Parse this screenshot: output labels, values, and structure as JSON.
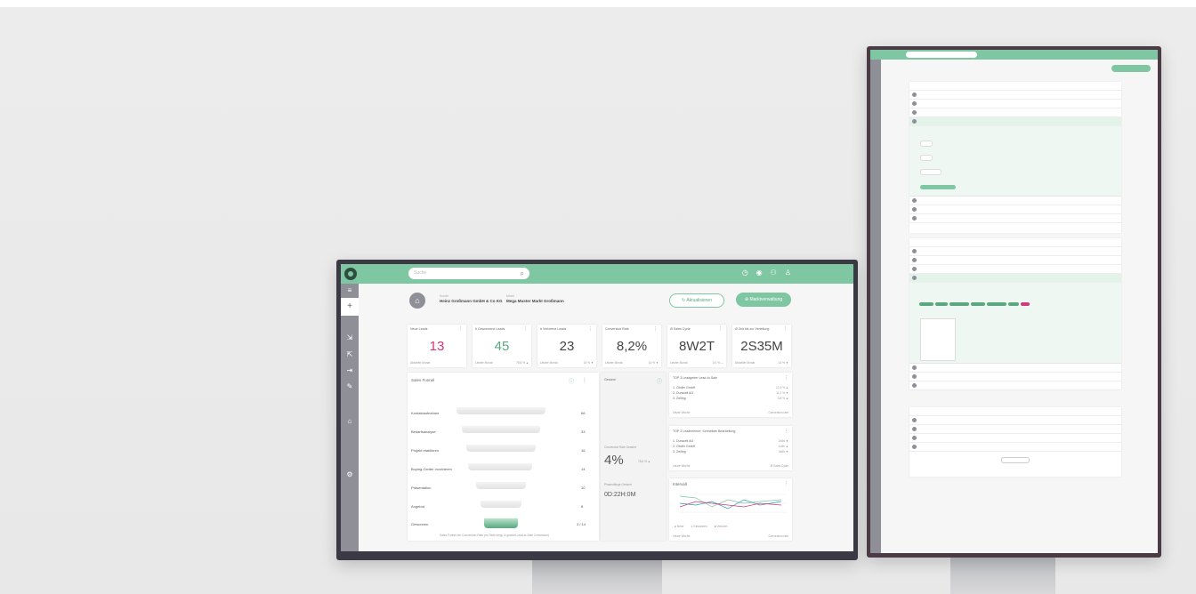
{
  "dashboard": {
    "search_placeholder": "Suche",
    "meta": {
      "kunde_label": "Kunde",
      "kunde_value": "Heinz Großmann GmbH & Co KG",
      "markt_label": "Markt",
      "markt_value": "Mega Muster Markt Großmann"
    },
    "buttons": {
      "refresh": "Aktualisieren",
      "market": "Marktverwaltung"
    },
    "kpis": [
      {
        "title": "Neue Leads",
        "value": "13",
        "value_color": "#d0397a",
        "footer": "Aktueller Monat",
        "footer_right": ""
      },
      {
        "title": "# Gewonnene Leads",
        "value": "45",
        "value_color": "#5aa880",
        "footer": "Letzter Monat",
        "footer_right": "78,6 % ▲"
      },
      {
        "title": "# Verlorene Leads",
        "value": "23",
        "value_color": "#444444",
        "footer": "Letzter Monat",
        "footer_right": "14 % ▼"
      },
      {
        "title": "Conversion Rate",
        "value": "8,2%",
        "value_color": "#444444",
        "footer": "Letzter Monat",
        "footer_right": "14 % ▼"
      },
      {
        "title": "Ø Sales Cycle",
        "value": "8W2T",
        "value_color": "#444444",
        "footer": "Letzter Monat",
        "footer_right": "0,0 % —"
      },
      {
        "title": "Ø Zeit bis zur Verteilung",
        "value": "2S35M",
        "value_color": "#444444",
        "footer": "Aktueller Monat",
        "footer_right": "14 % ▼"
      }
    ],
    "funnel": {
      "title": "Sales Funnel",
      "stages": [
        {
          "label": "Kontaktaufnahme",
          "value": "66"
        },
        {
          "label": "Bedarfsanalyse",
          "value": "33"
        },
        {
          "label": "Projekt etablieren",
          "value": "16"
        },
        {
          "label": "Buying-Center involvieren",
          "value": "14"
        },
        {
          "label": "Präsentation",
          "value": "10"
        },
        {
          "label": "Angebot",
          "value": "8"
        },
        {
          "label": "Gewonnen",
          "value": "3 / 14"
        }
      ],
      "caption": "Sales-Funnel der Conversion-Rate pro Stufe zeigt, & gesamt Lead-to-Sale Conversion)"
    },
    "gesamt": {
      "label": "Gesamt",
      "conv_label": "Conversion Rate Gesamt",
      "conv_value": "4%",
      "conv_delta": "78,6 % ▲",
      "time_label": "Phasenlänge Gesamt",
      "time_value": "0D:22H:0M"
    },
    "top3_conversion": {
      "title": "TOP 3 Leadgeber Lead-to-Sale",
      "items": [
        {
          "name": "1. Ohder GmbH",
          "val": "12,4 % ▲"
        },
        {
          "name": "2. Duracell AG",
          "val": "11,2 % ▼"
        },
        {
          "name": "3. Zeiling",
          "val": "3,8 % ▲"
        }
      ],
      "footer_left": "Letzte Woche",
      "footer_right": "Conversion rate"
    },
    "top3_fast": {
      "title": "TOP 3 Leadnehmer: Schnellste Bearbeitung",
      "items": [
        {
          "name": "1. Duracell AG",
          "val": "2d4h ▼"
        },
        {
          "name": "2. Ohder GmbH",
          "val": "1d4h ▲"
        },
        {
          "name": "3. Zeiling",
          "val": "3d4h ▼"
        }
      ],
      "footer_left": "Letzte Woche",
      "footer_right": "Ø Sales Cycle"
    },
    "intervall": {
      "title": "Intervall",
      "legend": [
        "Neue",
        "Gewonnen",
        "Verloren"
      ],
      "footer_left": "Letzte Woche",
      "footer_right": "Conversion rate"
    }
  },
  "colors": {
    "accent": "#7fc7a2",
    "sidebar": "#8f8f98",
    "pink": "#d0397a"
  }
}
